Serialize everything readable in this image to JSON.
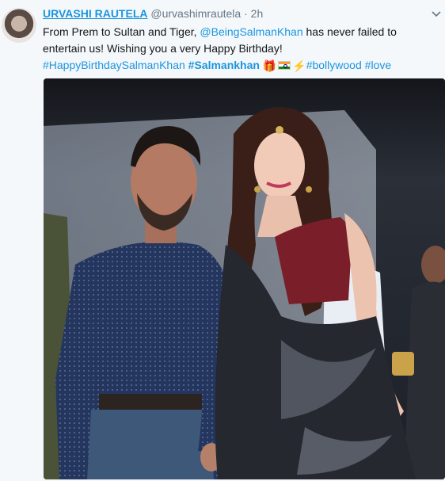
{
  "tweet": {
    "display_name": "URVASHI RAUTELA",
    "handle": "@urvashimrautela",
    "separator": "·",
    "time": "2h",
    "text_part1": "From Prem to Sultan and Tiger, ",
    "mention": "@BeingSalmanKhan",
    "text_part2": " has never failed to entertain us! Wishing you a very Happy Birthday!",
    "hashtag1": "#HappyBirthdaySalmanKhan",
    "hashtag2": "#Salmankhan",
    "emoji_gift": "🎁",
    "emoji_bolt": "⚡",
    "hashtag3": "#bollywood",
    "hashtag4": "#love"
  },
  "icons": [
    "avatar",
    "chevron-down-icon",
    "gift-emoji",
    "india-flag-emoji",
    "lightning-emoji"
  ],
  "colors": {
    "link": "#1b95e0",
    "muted": "#657786",
    "background": "#f5f8fa"
  }
}
